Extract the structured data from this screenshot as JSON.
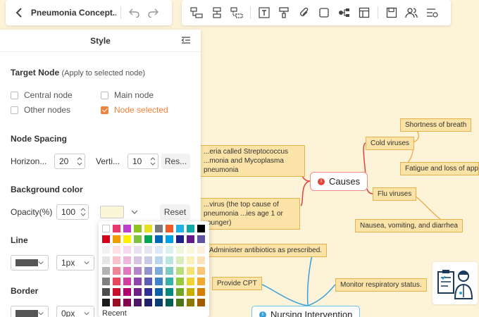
{
  "header": {
    "title": "Pneumonia Concept...",
    "icons": [
      "back-icon",
      "undo-icon",
      "redo-icon"
    ]
  },
  "toolbar": {
    "icons": [
      "insert-topic-icon",
      "insert-subtopic-icon",
      "insert-floating-topic-icon",
      "text-icon",
      "format-painter-icon",
      "attachment-icon",
      "shape-icon",
      "layout-icon",
      "table-icon",
      "save-icon",
      "collaborate-icon",
      "outline-icon"
    ]
  },
  "panel": {
    "title": "Style",
    "target_node": {
      "heading": "Target Node",
      "subheading": "(Apply to selected node)",
      "options": [
        {
          "label": "Central node",
          "checked": false
        },
        {
          "label": "Main node",
          "checked": false
        },
        {
          "label": "Other nodes",
          "checked": false
        },
        {
          "label": "Node selected",
          "checked": true
        }
      ]
    },
    "node_spacing": {
      "heading": "Node Spacing",
      "horizontal_label": "Horizon...",
      "horizontal_value": "20",
      "vertical_label": "Verti...",
      "vertical_value": "10",
      "reset_label": "Res..."
    },
    "background_color": {
      "heading": "Background color",
      "opacity_label": "Opacity(%)",
      "opacity_value": "100",
      "swatch_color": "#fdf5d8",
      "reset_label": "Reset"
    },
    "line": {
      "heading": "Line",
      "color": "#555555",
      "width_value": "1px"
    },
    "border": {
      "heading": "Border",
      "color": "#555555",
      "width_value": "0px"
    }
  },
  "color_picker": {
    "colors": [
      "#ffffff",
      "#e8386d",
      "#c03ccf",
      "#8fc31f",
      "#e5e020",
      "#7a7a7a",
      "#ef5a28",
      "#21b1e6",
      "#11a8a8",
      "#000000",
      "#d6001c",
      "#f29c00",
      "#fff100",
      "#7fc241",
      "#00a651",
      "#0068b7",
      "#00a0e9",
      "#1d2088",
      "#601986",
      "#5f52a0",
      "#f2f2f2",
      "#fbe0e4",
      "#f6d9ee",
      "#ece0f0",
      "#e4e4f3",
      "#dbe9f6",
      "#dcf1f0",
      "#eef6dc",
      "#fcf8dc",
      "#fdf0dc",
      "#e6e6e6",
      "#f8c3cc",
      "#efb7de",
      "#d9c2e4",
      "#c9c9e8",
      "#bad4ee",
      "#bae5e1",
      "#dcedbd",
      "#f9f1b8",
      "#fbe2b8",
      "#b3b3b3",
      "#f08597",
      "#e278bf",
      "#b485c9",
      "#9292d0",
      "#7dabdb",
      "#79cbc3",
      "#b9dc7c",
      "#f2e374",
      "#f7c676",
      "#808080",
      "#e8485f",
      "#d33ea0",
      "#8f47ad",
      "#5b5bb8",
      "#3f82c9",
      "#37b0a6",
      "#96c93d",
      "#eed534",
      "#f1a930",
      "#4d4d4d",
      "#c8102e",
      "#b4006e",
      "#6d1f8a",
      "#2e2e96",
      "#0b5ea8",
      "#008a7e",
      "#6fa625",
      "#c8b000",
      "#d67d00",
      "#1a1a1a",
      "#9b0d24",
      "#87004f",
      "#4f1666",
      "#1f1f6b",
      "#083f73",
      "#005e55",
      "#4c7519",
      "#8a7a00",
      "#a15c00"
    ],
    "recent_label": "Recent"
  },
  "map": {
    "central_causes": "Causes",
    "central_nursing": "Nursing Intervention",
    "nodes": {
      "bacteria": "...eria called Streptococcus ...monia and Mycoplasma pneumonia",
      "virus": "...virus (the top cause of pneumonia ...ies age 1 or younger)",
      "cold_viruses": "Cold viruses",
      "flu_viruses": "Flu viruses",
      "shortness": "Shortness of breath",
      "fatigue": "Fatigue and loss of appet...",
      "nausea": "Nausea, vomiting, and diarrhea",
      "antibiotics": "Administer antibiotics as prescribed.",
      "cpt": "Provide CPT",
      "monitor": "Monitor respiratory status."
    },
    "colors": {
      "node_fill": "#fbe3a7",
      "node_border": "#e6b34a",
      "causes_link": "#e0443b",
      "nursing_link": "#3aa0d8",
      "symptom_link": "#f0a33a"
    }
  },
  "illustration": {
    "icon": "doctor-with-clipboard-icon"
  }
}
